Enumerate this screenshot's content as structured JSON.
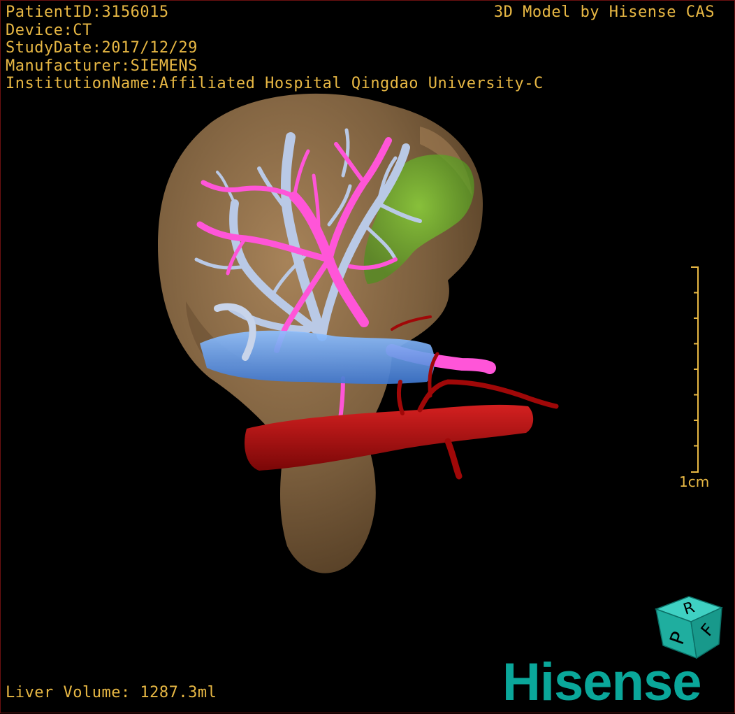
{
  "overlay": {
    "patient_id": "PatientID:3156015",
    "device": "Device:CT",
    "study_date": "StudyDate:2017/12/29",
    "manufacturer": "Manufacturer:SIEMENS",
    "institution": "InstitutionName:Affiliated Hospital Qingdao University-C",
    "brand_caption": "3D Model by Hisense CAS",
    "liver_volume": "Liver Volume: 1287.3ml"
  },
  "scale_bar": {
    "label": "1cm"
  },
  "orientation_cube": {
    "faces": [
      "P",
      "R",
      "F"
    ]
  },
  "logo": {
    "text": "Hisense"
  },
  "colors": {
    "overlay_text": "#e8b844",
    "liver": "#8a6a45",
    "hepatic_vein": "#b9c9e6",
    "portal_vein": "#ff55d8",
    "ivc": "#5f9be8",
    "aorta": "#b00d0d",
    "tumor": "#6fc22b",
    "logo": "#0aa79a"
  }
}
